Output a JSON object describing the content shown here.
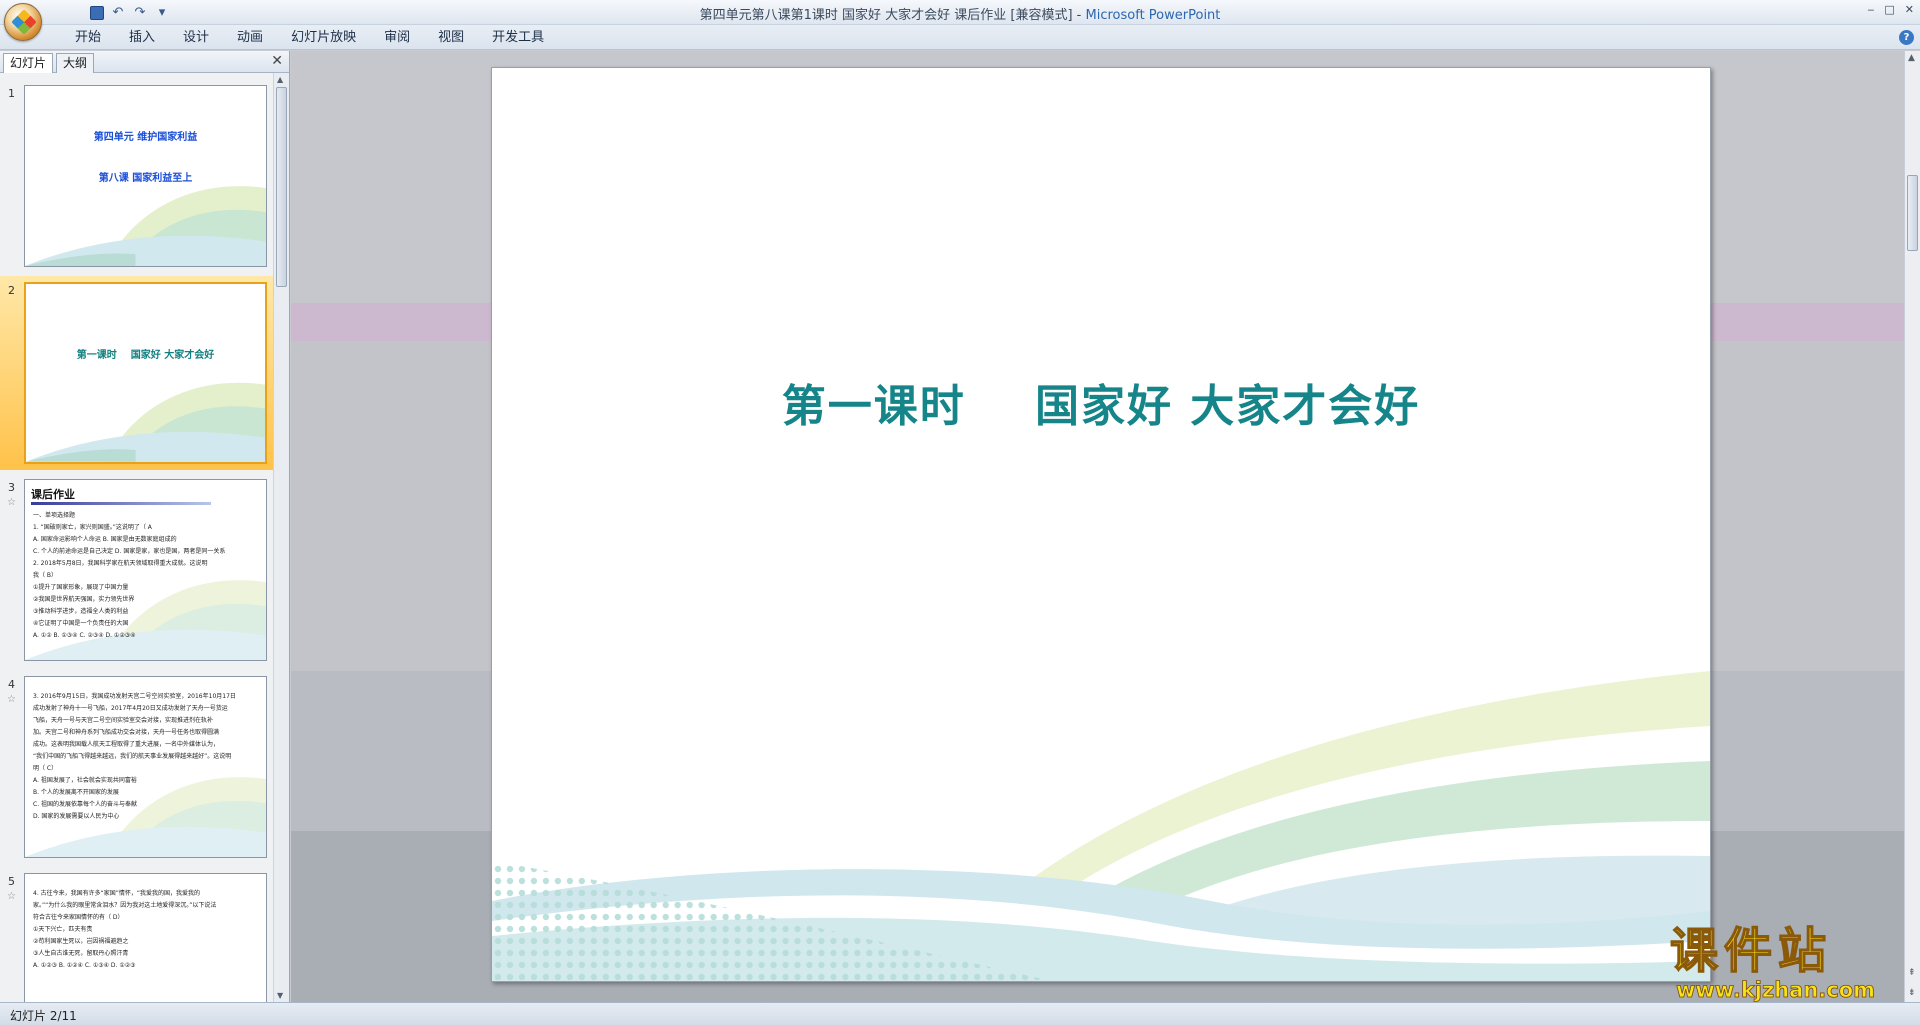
{
  "window": {
    "title": "第四单元第八课第1课时 国家好 大家才会好 课后作业 [兼容模式] - ",
    "app_name": "Microsoft PowerPoint",
    "controls": [
      "‒",
      "□",
      "✕"
    ]
  },
  "quick_access": {
    "icons": [
      "save-icon",
      "undo-icon",
      "redo-icon",
      "customize-icon"
    ],
    "undo_glyph": "↶",
    "redo_glyph": "↷",
    "more_glyph": "▾"
  },
  "ribbon": {
    "tabs": [
      "开始",
      "插入",
      "设计",
      "动画",
      "幻灯片放映",
      "审阅",
      "视图",
      "开发工具"
    ],
    "help_glyph": "?"
  },
  "left_pane": {
    "tabs": [
      "幻灯片",
      "大纲"
    ],
    "close_glyph": "✕",
    "slides": [
      {
        "number": "1",
        "line1": "第四单元  维护国家利益",
        "line2": "第八课    国家利益至上"
      },
      {
        "number": "2",
        "title": "第一课时    国家好 大家才会好"
      },
      {
        "number": "3",
        "star": "☆",
        "heading": "课后作业",
        "lines": [
          "一、单项选择题",
          "1. “国破则家亡，家兴则国盛。”这说明了（  A",
          "A. 国家命运影响个人命运          B. 国家是由无数家庭组成的",
          "C. 个人的前途命运是自己决定      D. 国家是家，家也是国，两者是同一关系",
          "2. 2018年5月8日，我国科学家在航天领域取得重大成就。这说明",
          "我（  B）",
          "①提升了国家形象，展现了中国力量",
          "②我国是世界航天强国，实力领先世界",
          "③推动科学进步，造福全人类的利益",
          "④它证明了中国是一个负责任的大国",
          "A. ①②   B. ①③④   C. ②③④   D. ①②③④"
        ]
      },
      {
        "number": "4",
        "star": "☆",
        "lines": [
          "3. 2016年9月15日，我国成功发射天宫二号空间实验室，2016年10月17日",
          "成功发射了神舟十一号飞船，2017年4月20日又成功发射了天舟一号货运",
          "飞船，天舟一号与天宫二号空间实验室交会对接，实现推进剂在轨补",
          "加。天宫二号和神舟系列飞船成功交会对接，天舟一号任务也取得圆满",
          "成功。这表明我国载人航天工程取得了重大进展，一名中外媒体认为，",
          "“我们中国的飞船飞得越来越远，我们的航天事业发展得越来越好”。这说明",
          "明（  C）",
          "A. 祖国发展了，社会就会实现共同富裕",
          "B. 个人的发展离不开国家的发展",
          "C. 祖国的发展依靠每个人的奋斗与奉献",
          "D. 国家的发展需要以人民为中心"
        ]
      },
      {
        "number": "5",
        "star": "☆",
        "lines": [
          "4. 古往今来，我国有许多“家国”情怀，“我爱我的国，我爱我的",
          "家。”“为什么我的眼里常含泪水？因为我对这土地爱得深沉。”以下说法",
          "符合古往今来家国情怀的有（  D）",
          "①天下兴亡，匹夫有责",
          "②苟利国家生死以，岂因祸福避趋之",
          "③人生自古谁无死，留取丹心照汗青",
          "A. ①②③   B. ①②④   C. ①③④   D. ①②③"
        ]
      }
    ]
  },
  "slide": {
    "title": "第一课时    国家好 大家才会好"
  },
  "watermark": {
    "big": "课件站",
    "url": "www.kjzhan.com"
  },
  "status_bar": {
    "text": "幻灯片 2/11"
  },
  "colors": {
    "slide_title": "#15858a",
    "thumb_title_blue": "#1a4fd8",
    "selection": "#ffc24a"
  }
}
